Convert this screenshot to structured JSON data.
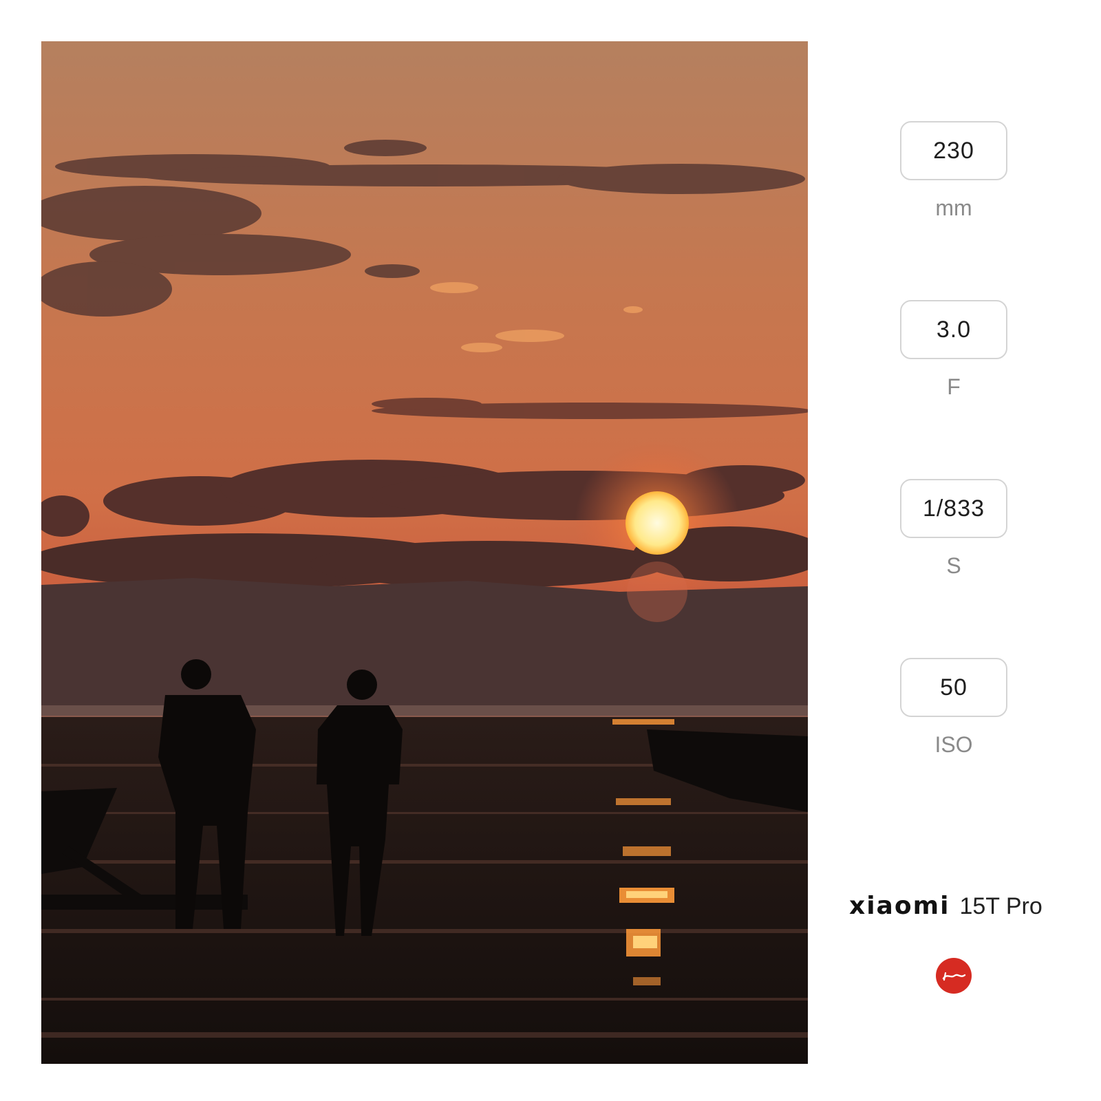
{
  "exif": {
    "focal_length": {
      "value": "230",
      "unit": "mm"
    },
    "aperture": {
      "value": "3.0",
      "unit": "F"
    },
    "shutter": {
      "value": "1/833",
      "unit": "S"
    },
    "iso": {
      "value": "50",
      "unit": "ISO"
    }
  },
  "brand": {
    "logo_text": "xiaomi",
    "model": "15T Pro",
    "badge_text": "Leica",
    "badge_color": "#d62b22"
  },
  "colors": {
    "sky_top": "#b97a5a",
    "sky_mid": "#d0714a",
    "sky_low": "#c4553a",
    "sun": "#fff2a8",
    "ground": "#1e1512"
  }
}
